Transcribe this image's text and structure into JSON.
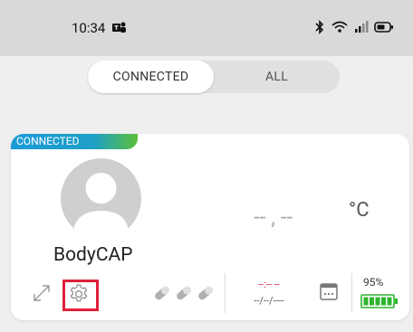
{
  "status_bar": {
    "time": "10:34",
    "app_icon": "teams-icon",
    "icons": [
      "bluetooth-icon",
      "wifi-icon",
      "signal-icon",
      "battery-icon"
    ]
  },
  "segment": {
    "connected_label": "CONNECTED",
    "all_label": "ALL",
    "selected": "CONNECTED"
  },
  "device_card": {
    "badge": "CONNECTED",
    "device_name": "BodyCAP",
    "temperature_value": "-- , --",
    "temperature_unit": "°C",
    "last_time": "--:-- --",
    "last_date": "--/--/----",
    "battery_percent": "95%",
    "battery_level": 0.95,
    "pills_count": 3,
    "colors": {
      "badge_start": "#1e9bd7",
      "badge_end": "#5cbf3a",
      "battery_green": "#2db52d",
      "highlight_red": "#e0203a"
    }
  }
}
